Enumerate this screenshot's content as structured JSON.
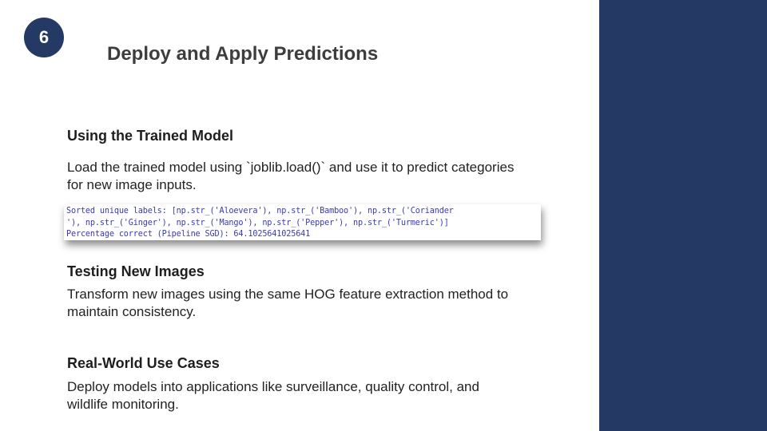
{
  "slide": {
    "step_number": "6",
    "title": "Deploy and Apply Predictions"
  },
  "sections": [
    {
      "heading": "Using the Trained Model",
      "body": "Load the trained model using `joblib.load()` and use it to predict categories for new image inputs."
    },
    {
      "heading": "Testing New Images",
      "body": "Transform new images using the same HOG feature extraction method to maintain consistency."
    },
    {
      "heading": "Real-World Use Cases",
      "body": "Deploy models into applications like surveillance, quality control, and wildlife monitoring."
    }
  ],
  "code_output": {
    "lines": [
      "Sorted unique labels: [np.str_('Aloevera'), np.str_('Bamboo'), np.str_('Coriander",
      "'), np.str_('Ginger'), np.str_('Mango'), np.str_('Pepper'), np.str_('Turmeric')]",
      "Percentage correct (Pipeline SGD): 64.1025641025641"
    ]
  },
  "colors": {
    "accent": "#243a64",
    "code_text": "#3a3ab8"
  }
}
